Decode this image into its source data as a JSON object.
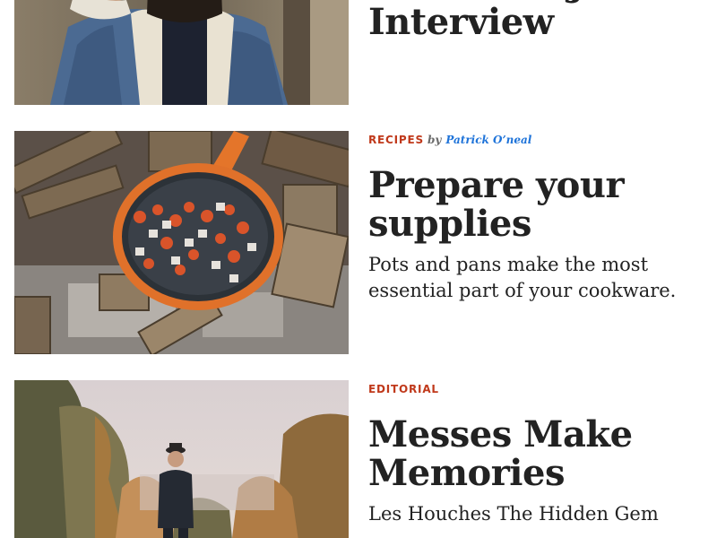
{
  "posts": [
    {
      "category": "",
      "by": "",
      "author": "",
      "title": "Technical Job Interview",
      "excerpt": "",
      "image": "man-in-denim-jacket-photo"
    },
    {
      "category": "RECIPES",
      "by": "by",
      "author": "Patrick O’neal",
      "title": "Prepare your supplies",
      "excerpt": "Pots and pans make the most essential part of your cookware.",
      "image": "campfire-skillet-photo"
    },
    {
      "category": "EDITORIAL",
      "by": "",
      "author": "",
      "title": "Messes Make Memories",
      "excerpt": "Les Houches The Hidden Gem",
      "image": "man-in-autumn-forest-photo"
    }
  ],
  "colors": {
    "category": "#c0391b",
    "author": "#1e73d9",
    "title": "#222222",
    "byline": "#6b6b6b"
  }
}
